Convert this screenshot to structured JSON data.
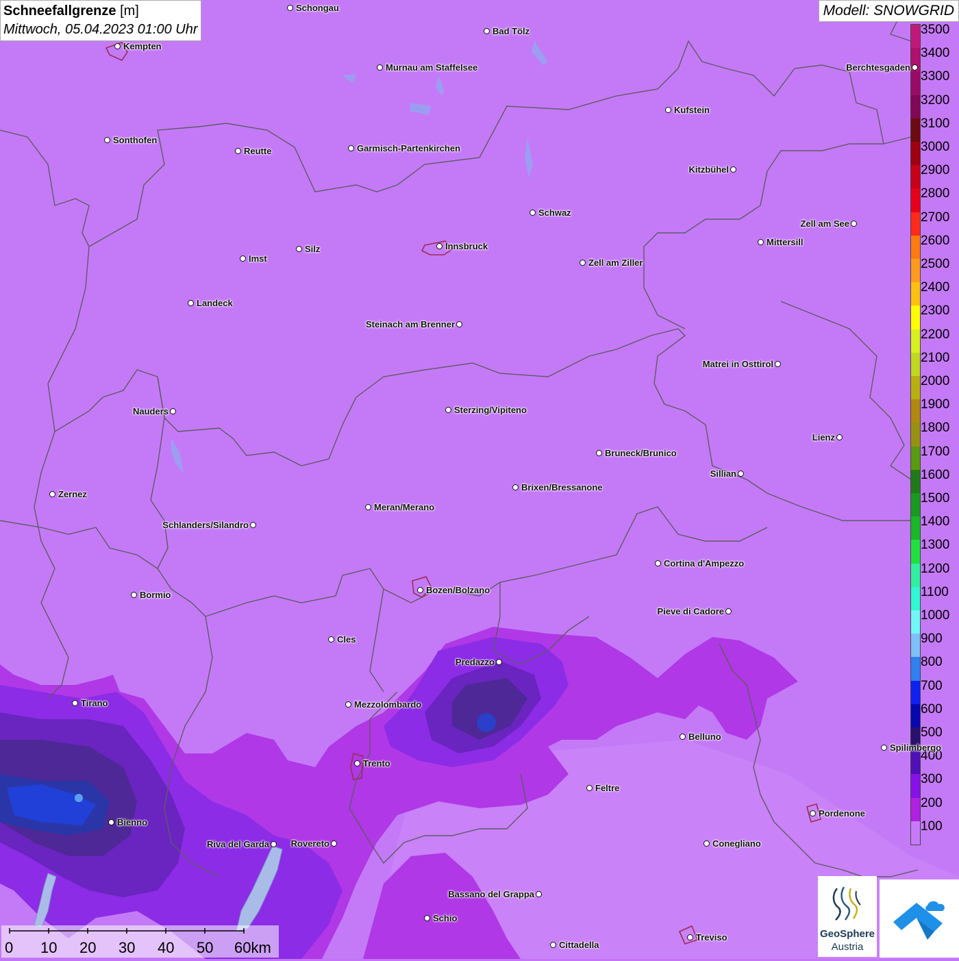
{
  "title": {
    "label": "Schneefallgrenze",
    "unit": "[m]",
    "datetime": "Mittwoch, 05.04.2023 01:00 Uhr"
  },
  "model": "Modell: SNOWGRID",
  "legend": [
    {
      "value": "3500",
      "color": "#c2187a"
    },
    {
      "value": "3400",
      "color": "#b0106e"
    },
    {
      "value": "3300",
      "color": "#9a0a66"
    },
    {
      "value": "3200",
      "color": "#800856"
    },
    {
      "value": "3100",
      "color": "#6e0a10"
    },
    {
      "value": "3000",
      "color": "#a00010"
    },
    {
      "value": "2900",
      "color": "#c80018"
    },
    {
      "value": "2800",
      "color": "#e80018"
    },
    {
      "value": "2700",
      "color": "#ff2a1a"
    },
    {
      "value": "2600",
      "color": "#ff7a10"
    },
    {
      "value": "2500",
      "color": "#ff9a20"
    },
    {
      "value": "2400",
      "color": "#ffc010"
    },
    {
      "value": "2300",
      "color": "#ffff00"
    },
    {
      "value": "2200",
      "color": "#d8f020"
    },
    {
      "value": "2100",
      "color": "#c0d820"
    },
    {
      "value": "2000",
      "color": "#b8b010"
    },
    {
      "value": "1900",
      "color": "#b08810"
    },
    {
      "value": "1800",
      "color": "#989010"
    },
    {
      "value": "1700",
      "color": "#5a9a10"
    },
    {
      "value": "1600",
      "color": "#207a18"
    },
    {
      "value": "1500",
      "color": "#1a9a20"
    },
    {
      "value": "1400",
      "color": "#18b828"
    },
    {
      "value": "1300",
      "color": "#20e040"
    },
    {
      "value": "1200",
      "color": "#30f0a0"
    },
    {
      "value": "1100",
      "color": "#30f8d0"
    },
    {
      "value": "1000",
      "color": "#70f8f8"
    },
    {
      "value": "900",
      "color": "#80c0f8"
    },
    {
      "value": "800",
      "color": "#3080f0"
    },
    {
      "value": "700",
      "color": "#1020f0"
    },
    {
      "value": "600",
      "color": "#0808b0"
    },
    {
      "value": "500",
      "color": "#28126e"
    },
    {
      "value": "400",
      "color": "#5010b8"
    },
    {
      "value": "300",
      "color": "#8810e8"
    },
    {
      "value": "200",
      "color": "#b020e0"
    },
    {
      "value": "100",
      "color": "#c77af8"
    }
  ],
  "cities": [
    {
      "name": "Schongau",
      "labelpos": "right"
    },
    {
      "name": "Bad Tölz",
      "labelpos": "right"
    },
    {
      "name": "Kempten",
      "labelpos": "right"
    },
    {
      "name": "Murnau am Staffelsee",
      "labelpos": "right"
    },
    {
      "name": "Berchtesgaden",
      "labelpos": "left"
    },
    {
      "name": "Kufstein",
      "labelpos": "right"
    },
    {
      "name": "Sonthofen",
      "labelpos": "right"
    },
    {
      "name": "Reutte",
      "labelpos": "right"
    },
    {
      "name": "Garmisch-Partenkirchen",
      "labelpos": "right"
    },
    {
      "name": "Kitzbühel",
      "labelpos": "left"
    },
    {
      "name": "Schwaz",
      "labelpos": "right"
    },
    {
      "name": "Zell am See",
      "labelpos": "left"
    },
    {
      "name": "Innsbruck",
      "labelpos": "right"
    },
    {
      "name": "Mittersill",
      "labelpos": "right"
    },
    {
      "name": "Silz",
      "labelpos": "right"
    },
    {
      "name": "Imst",
      "labelpos": "right"
    },
    {
      "name": "Zell am Ziller",
      "labelpos": "right"
    },
    {
      "name": "Landeck",
      "labelpos": "right"
    },
    {
      "name": "Steinach am Brenner",
      "labelpos": "left"
    },
    {
      "name": "Matrei in Osttirol",
      "labelpos": "left"
    },
    {
      "name": "Nauders",
      "labelpos": "left"
    },
    {
      "name": "Sterzing/Vipiteno",
      "labelpos": "right"
    },
    {
      "name": "Lienz",
      "labelpos": "left"
    },
    {
      "name": "Bruneck/Brunico",
      "labelpos": "right"
    },
    {
      "name": "Sillian",
      "labelpos": "left"
    },
    {
      "name": "Brixen/Bressanone",
      "labelpos": "right"
    },
    {
      "name": "Zernez",
      "labelpos": "right"
    },
    {
      "name": "Meran/Merano",
      "labelpos": "right"
    },
    {
      "name": "Schlanders/Silandro",
      "labelpos": "left"
    },
    {
      "name": "Cortina d'Ampezzo",
      "labelpos": "right"
    },
    {
      "name": "Bozen/Bolzano",
      "labelpos": "right"
    },
    {
      "name": "Bormio",
      "labelpos": "right"
    },
    {
      "name": "Pieve di Cadore",
      "labelpos": "left"
    },
    {
      "name": "Cles",
      "labelpos": "right"
    },
    {
      "name": "Predazzo",
      "labelpos": "left"
    },
    {
      "name": "Tirano",
      "labelpos": "right"
    },
    {
      "name": "Mezzolombardo",
      "labelpos": "right"
    },
    {
      "name": "Belluno",
      "labelpos": "right"
    },
    {
      "name": "Spilimbergo",
      "labelpos": "right"
    },
    {
      "name": "Trento",
      "labelpos": "right"
    },
    {
      "name": "Feltre",
      "labelpos": "right"
    },
    {
      "name": "Pordenone",
      "labelpos": "right"
    },
    {
      "name": "Bienno",
      "labelpos": "right"
    },
    {
      "name": "Riva del Garda",
      "labelpos": "left"
    },
    {
      "name": "Rovereto",
      "labelpos": "left"
    },
    {
      "name": "Conegliano",
      "labelpos": "right"
    },
    {
      "name": "Bassano del Grappa",
      "labelpos": "left"
    },
    {
      "name": "Schio",
      "labelpos": "right"
    },
    {
      "name": "Treviso",
      "labelpos": "right"
    },
    {
      "name": "Cittadella",
      "labelpos": "right"
    }
  ],
  "scalebar": {
    "labels": [
      "0",
      "10",
      "20",
      "30",
      "40",
      "50",
      "60km"
    ]
  },
  "logos": {
    "geosphere_line1": "GeoSphere",
    "geosphere_line2": "Austria"
  }
}
